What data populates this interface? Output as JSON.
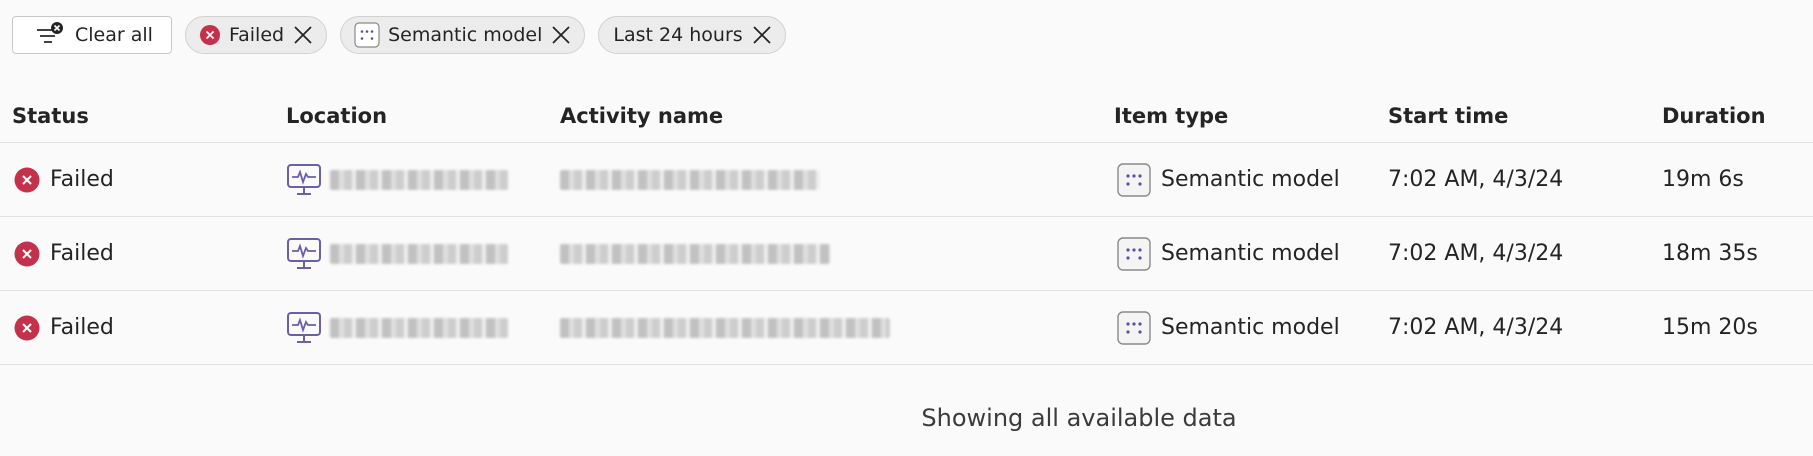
{
  "filters": {
    "clear_all_label": "Clear all",
    "chips": [
      {
        "label": "Failed",
        "icon": "status-failed-icon"
      },
      {
        "label": "Semantic model",
        "icon": "semantic-model-icon"
      },
      {
        "label": "Last 24 hours",
        "icon": null
      }
    ]
  },
  "table": {
    "columns": [
      "Status",
      "Location",
      "Activity name",
      "Item type",
      "Start time",
      "Duration"
    ],
    "rows": [
      {
        "status": "Failed",
        "location": "",
        "activity": "",
        "item_type": "Semantic model",
        "start_time": "7:02 AM, 4/3/24",
        "duration": "19m 6s"
      },
      {
        "status": "Failed",
        "location": "",
        "activity": "",
        "item_type": "Semantic model",
        "start_time": "7:02 AM, 4/3/24",
        "duration": "18m 35s"
      },
      {
        "status": "Failed",
        "location": "",
        "activity": "",
        "item_type": "Semantic model",
        "start_time": "7:02 AM, 4/3/24",
        "duration": "15m 20s"
      }
    ]
  },
  "footer": {
    "text": "Showing all available data"
  },
  "colors": {
    "failed": "#c4314b",
    "accent": "#6b5fa8"
  }
}
